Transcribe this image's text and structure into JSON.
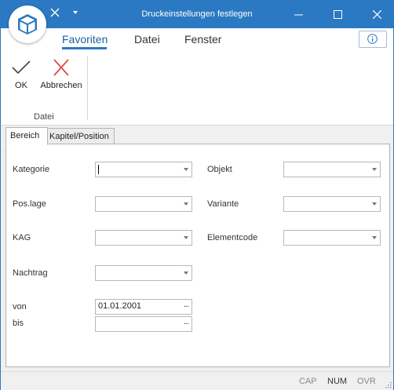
{
  "window": {
    "title": "Druckeinstellungen festlegen"
  },
  "icons": {
    "app": "cube-logo-icon",
    "quick_access": "x-tool-icon",
    "quick_access_menu": "dropdown-arrow-icon",
    "info": "info-icon",
    "ok": "checkmark-icon",
    "cancel": "red-x-icon"
  },
  "menu": {
    "items": [
      "Favoriten",
      "Datei",
      "Fenster"
    ],
    "active": "Favoriten"
  },
  "ribbon": {
    "ok_label": "OK",
    "cancel_label": "Abbrechen",
    "group_label": "Datei"
  },
  "tabs": [
    {
      "label": "Bereich",
      "active": true
    },
    {
      "label": "Kapitel/Position",
      "active": false
    }
  ],
  "form": {
    "kategorie": {
      "label": "Kategorie",
      "value": ""
    },
    "objekt": {
      "label": "Objekt",
      "value": ""
    },
    "poslage": {
      "label": "Pos.lage",
      "value": ""
    },
    "variante": {
      "label": "Variante",
      "value": ""
    },
    "kag": {
      "label": "KAG",
      "value": ""
    },
    "elementcode": {
      "label": "Elementcode",
      "value": ""
    },
    "nachtrag": {
      "label": "Nachtrag",
      "value": ""
    },
    "von": {
      "label": "von",
      "value": "01.01.2001",
      "button": "..."
    },
    "bis": {
      "label": "bis",
      "value": "",
      "button": "..."
    }
  },
  "status": {
    "cap": "CAP",
    "num": "NUM",
    "ovr": "OVR"
  },
  "colors": {
    "accent": "#2b79c2",
    "cancel_red": "#e04a4a"
  }
}
